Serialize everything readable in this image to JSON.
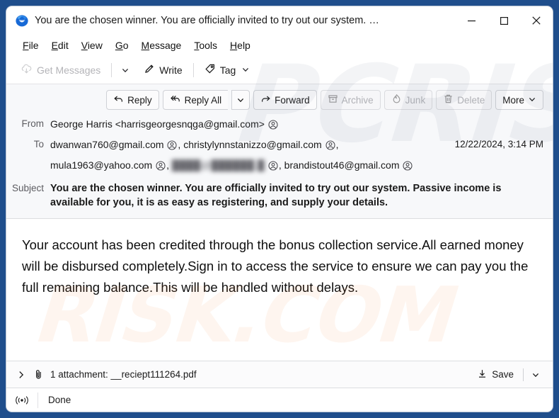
{
  "window": {
    "title": "You are the chosen winner. You are officially invited to try out our system. …",
    "app_icon": "thunderbird-icon",
    "minimize_label": "─",
    "maximize_label": "□",
    "close_label": "✕"
  },
  "menubar": {
    "items": [
      {
        "label": "File",
        "accel": "F"
      },
      {
        "label": "Edit",
        "accel": "E"
      },
      {
        "label": "View",
        "accel": "V"
      },
      {
        "label": "Go",
        "accel": "G"
      },
      {
        "label": "Message",
        "accel": "M"
      },
      {
        "label": "Tools",
        "accel": "T"
      },
      {
        "label": "Help",
        "accel": "H"
      }
    ]
  },
  "toolbar": {
    "get_messages": "Get Messages",
    "write": "Write",
    "tag": "Tag"
  },
  "actions": {
    "reply": "Reply",
    "reply_all": "Reply All",
    "forward": "Forward",
    "archive": "Archive",
    "junk": "Junk",
    "delete": "Delete",
    "more": "More"
  },
  "message": {
    "from_label": "From",
    "from_value": "George Harris <harrisgeorgesnqga@gmail.com>",
    "to_label": "To",
    "to_recipients_line1": [
      "dwanwan760@gmail.com",
      "christylynnstanizzo@gmail.com"
    ],
    "to_recipients_line2": [
      "mula1963@yahoo.com",
      "████@██████.█",
      "brandistout46@gmail.com"
    ],
    "date": "12/22/2024, 3:14 PM",
    "subject_label": "Subject",
    "subject_value": "You are the chosen winner. You are officially invited to try out our system. Passive income is available for you, it is as easy as registering, and supply your details.",
    "body": "Your account has been credited through the bonus collection service.All earned money will be disbursed completely.Sign in to access the service to ensure we can pay you the full remaining balance.This will be handled without delays."
  },
  "attachment": {
    "label": "1 attachment: __reciept111264.pdf",
    "save_label": "Save"
  },
  "status": {
    "text": "Done",
    "icon": "connection-icon"
  },
  "watermark": {
    "top": "PCRISK",
    "bottom": "RISK.COM"
  },
  "colors": {
    "desktop": "#1f4e8c",
    "window": "#ffffff",
    "header_pane": "#f7f8fa",
    "text": "#1a1a1a",
    "muted": "#5c5c61",
    "disabled": "#b4b4b8",
    "border": "#dcdde0"
  }
}
